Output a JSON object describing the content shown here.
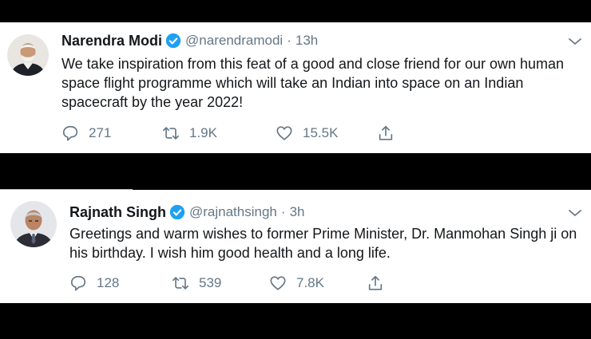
{
  "tweets": [
    {
      "name": "Narendra Modi",
      "handle": "@narendramodi",
      "separator": "·",
      "time": "13h",
      "text": "We take inspiration from this feat of a good and close friend for our own human space flight programme which will take an Indian into space on an Indian spacecraft by the year 2022!",
      "replies": "271",
      "retweets": "1.9K",
      "likes": "15.5K"
    },
    {
      "name": "Rajnath Singh",
      "handle": "@rajnathsingh",
      "separator": "·",
      "time": "3h",
      "text": "Greetings and warm wishes to former Prime Minister, Dr. Manmohan Singh ji on his birthday. I wish him good health and a long life.",
      "replies": "128",
      "retweets": "539",
      "likes": "7.8K"
    }
  ],
  "icons": {
    "verified": "verified-badge-icon",
    "menu": "chevron-down-icon",
    "reply": "reply-icon",
    "retweet": "retweet-icon",
    "like": "heart-icon",
    "share": "share-icon"
  },
  "colors": {
    "verified": "#1da1f2",
    "icon_gray": "#657786",
    "text": "#14171a",
    "accent_line": "#8fc4ef"
  }
}
